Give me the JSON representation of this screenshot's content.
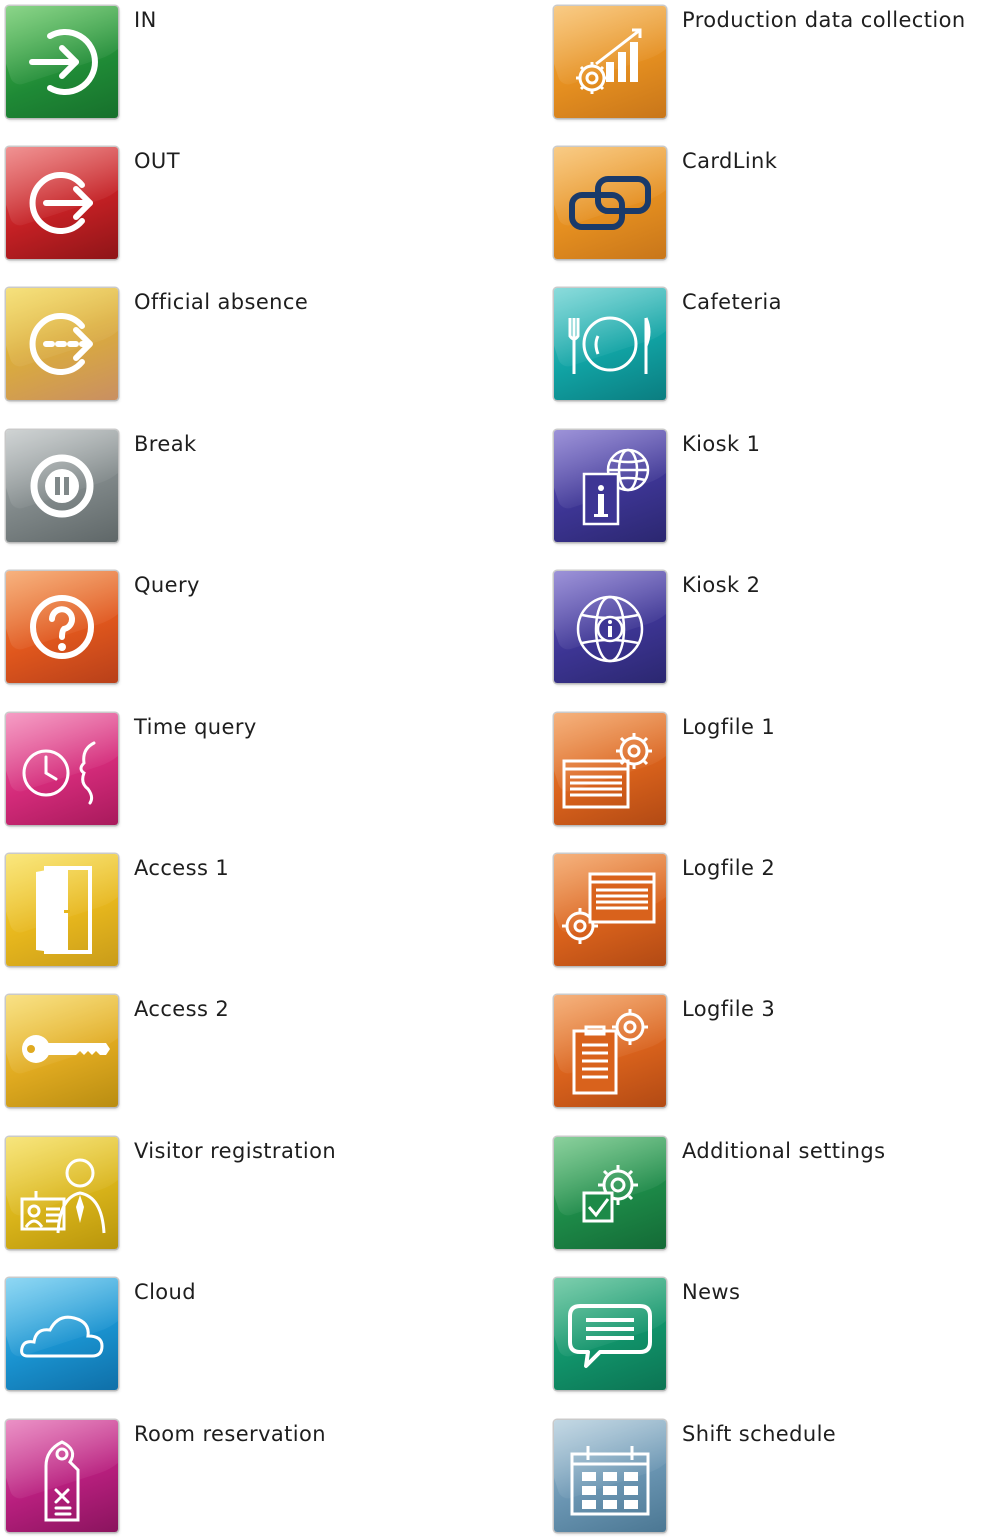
{
  "left_items": [
    {
      "label": "IN",
      "icon": "sign-in-icon",
      "color": "#1f8a36"
    },
    {
      "label": "OUT",
      "icon": "sign-out-icon",
      "color": "#c42024"
    },
    {
      "label": "Official absence",
      "icon": "official-absence-icon",
      "color": "#dcae3a"
    },
    {
      "label": "Break",
      "icon": "pause-icon",
      "color": "#808889"
    },
    {
      "label": "Query",
      "icon": "question-icon",
      "color": "#e0571d"
    },
    {
      "label": "Time query",
      "icon": "clock-query-icon",
      "color": "#d42b7a"
    },
    {
      "label": "Access 1",
      "icon": "door-icon",
      "color": "#e7b71d"
    },
    {
      "label": "Access 2",
      "icon": "key-icon",
      "color": "#e0aa20"
    },
    {
      "label": "Visitor registration",
      "icon": "visitor-badge-icon",
      "color": "#d9b41a"
    },
    {
      "label": "Cloud",
      "icon": "cloud-icon",
      "color": "#1a93d0"
    },
    {
      "label": "Room reservation",
      "icon": "door-hanger-icon",
      "color": "#b81f7e"
    }
  ],
  "right_items": [
    {
      "label": "Production data collection",
      "icon": "production-chart-gear-icon",
      "color": "#e58f20"
    },
    {
      "label": "CardLink",
      "icon": "chain-link-icon",
      "color": "#e58f20"
    },
    {
      "label": "Cafeteria",
      "icon": "plate-cutlery-icon",
      "color": "#11a3a4"
    },
    {
      "label": "Kiosk 1",
      "icon": "info-globe-icon",
      "color": "#3d3594"
    },
    {
      "label": "Kiosk 2",
      "icon": "globe-info-icon",
      "color": "#3d3594"
    },
    {
      "label": "Logfile 1",
      "icon": "logfile-gear-icon",
      "color": "#d9621c"
    },
    {
      "label": "Logfile 2",
      "icon": "logfile-gear-icon",
      "color": "#d9621c"
    },
    {
      "label": "Logfile 3",
      "icon": "clipboard-gear-icon",
      "color": "#d9621c"
    },
    {
      "label": "Additional settings",
      "icon": "settings-check-icon",
      "color": "#1d8a48"
    },
    {
      "label": "News",
      "icon": "speech-bubble-icon",
      "color": "#11936a"
    },
    {
      "label": "Shift schedule",
      "icon": "calendar-icon",
      "color": "#6a95b2"
    }
  ]
}
